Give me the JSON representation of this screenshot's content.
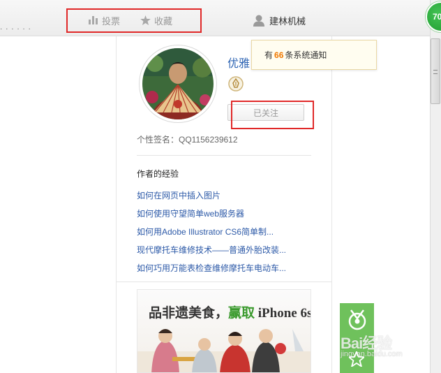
{
  "toolbar": {
    "vote_label": "投票",
    "collect_label": "收藏",
    "username": "建林机械",
    "left_fragment": "· · · · · ·"
  },
  "notification": {
    "prefix": "有",
    "count": "66",
    "suffix": "条系统通知"
  },
  "author": {
    "name": "优雅",
    "follow_label": "已关注",
    "signature": "个性签名：QQ1156239612"
  },
  "experience": {
    "title": "作者的经验",
    "links": [
      "如何在网页中插入图片",
      "如何使用守望简单web服务器",
      "如何用Adobe Illustrator CS6简单制...",
      "现代摩托车维修技术——普通外胎改装...",
      "如何巧用万能表检查维修摩托车电动车..."
    ]
  },
  "ad": {
    "text_part1": "品非遗美食，",
    "text_highlight": "赢取",
    "text_part2": " iPhone 6s"
  },
  "score": "70",
  "watermark": {
    "brand": "Bai经验",
    "url": "jingyan.baidu.com"
  },
  "colors": {
    "link": "#2d5aa8",
    "highlight_box": "#e02828",
    "notify_count": "#f07800",
    "score_green": "#1d9a2e"
  }
}
